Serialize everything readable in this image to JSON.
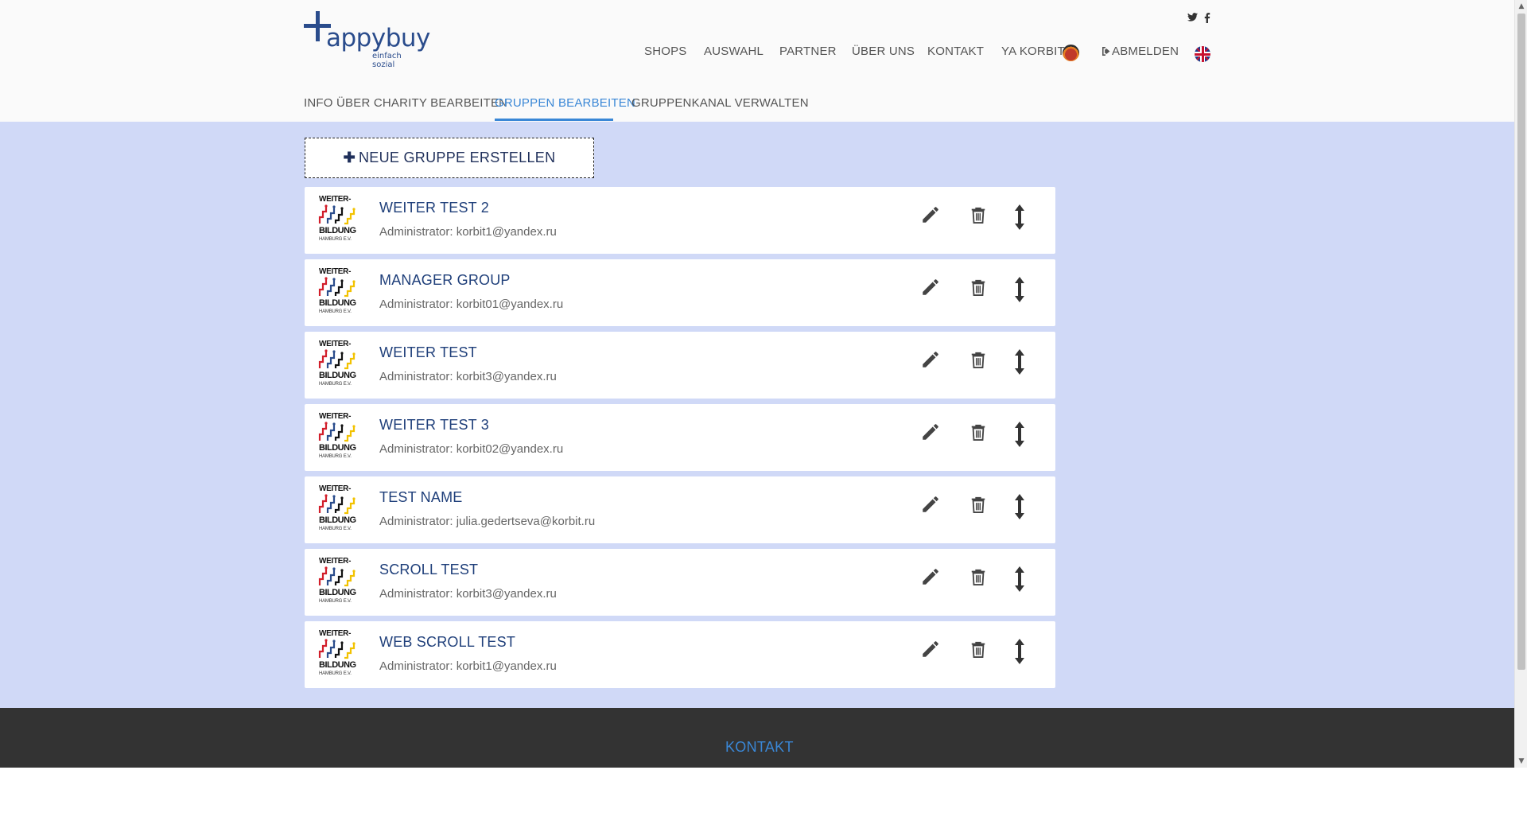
{
  "brand": {
    "name": "appybuy",
    "tagline": "einfach sozial"
  },
  "nav": {
    "items": [
      {
        "label": "SHOPS"
      },
      {
        "label": "AUSWAHL"
      },
      {
        "label": "PARTNER"
      },
      {
        "label": "ÜBER UNS"
      },
      {
        "label": "KONTAKT"
      },
      {
        "label": "YA KORBIT"
      }
    ],
    "logout": "ABMELDEN"
  },
  "social": {
    "twitter": "twitter-icon",
    "facebook": "facebook-icon"
  },
  "subnav": {
    "tabs": [
      {
        "label": "INFO ÜBER CHARITY BEARBEITEN",
        "active": false
      },
      {
        "label": "GRUPPEN BEARBEITEN",
        "active": true
      },
      {
        "label": "GRUPPENKANAL VERWALTEN",
        "active": false
      }
    ],
    "active_color": "#3a87d6"
  },
  "main": {
    "new_group_label": "NEUE GRUPPE ERSTELLEN",
    "background": "#d0d9f7",
    "group_logo": {
      "line1": "WEITER-",
      "line2": "BILDUNG",
      "line3": "HAMBURG E.V."
    },
    "groups": [
      {
        "name": "WEITER TEST 2",
        "admin": "Administrator: korbit1@yandex.ru"
      },
      {
        "name": "MANAGER GROUP",
        "admin": "Administrator: korbit01@yandex.ru"
      },
      {
        "name": "WEITER TEST",
        "admin": "Administrator: korbit3@yandex.ru"
      },
      {
        "name": "WEITER TEST 3",
        "admin": "Administrator: korbit02@yandex.ru"
      },
      {
        "name": "TEST NAME",
        "admin": "Administrator: julia.gedertseva@korbit.ru"
      },
      {
        "name": "SCROLL TEST",
        "admin": "Administrator: korbit3@yandex.ru"
      },
      {
        "name": "WEB SCROLL TEST",
        "admin": "Administrator: korbit1@yandex.ru"
      }
    ]
  },
  "footer": {
    "title": "KONTAKT"
  }
}
